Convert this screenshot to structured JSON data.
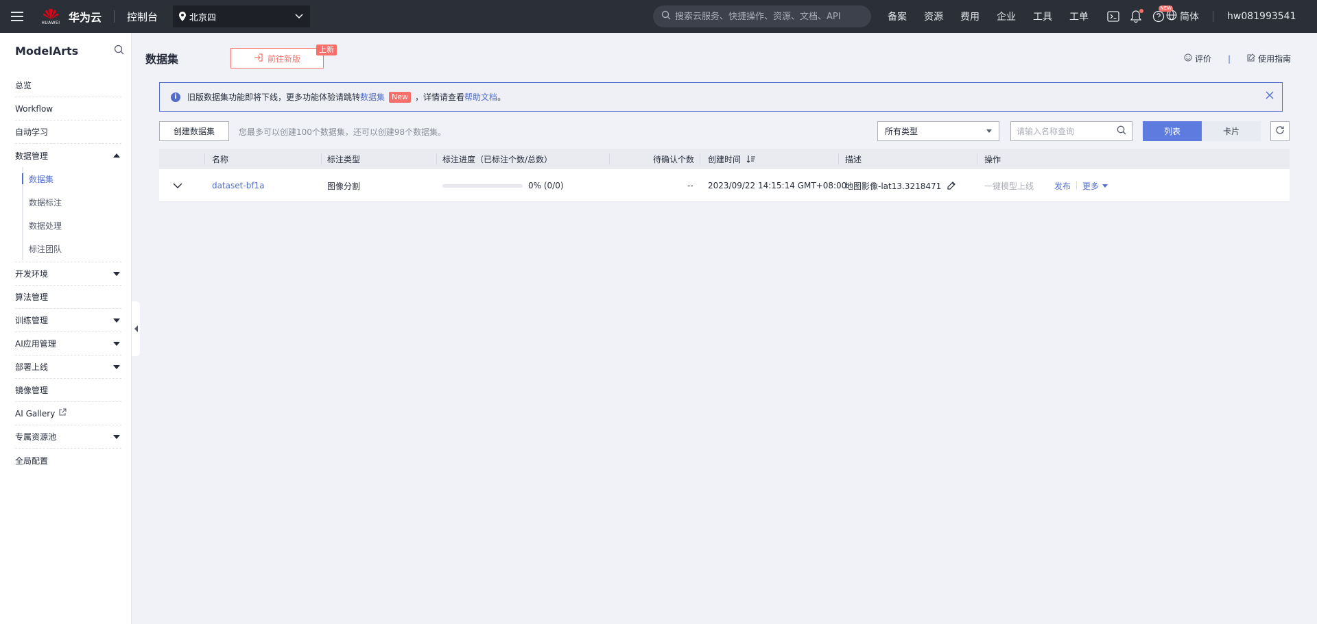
{
  "topbar": {
    "logo_text": "华为云",
    "logo_sub": "HUAWEI",
    "console": "控制台",
    "region": "北京四",
    "search_placeholder": "搜索云服务、快捷操作、资源、文档、API",
    "nav": [
      "备案",
      "资源",
      "费用",
      "企业",
      "工具",
      "工单"
    ],
    "new_tag": "NEW",
    "lang": "简体",
    "user": "hw081993541"
  },
  "sidebar": {
    "title": "ModelArts",
    "items": [
      {
        "label": "总览"
      },
      {
        "label": "Workflow"
      },
      {
        "label": "自动学习"
      },
      {
        "label": "数据管理",
        "expanded": true,
        "children": [
          "数据集",
          "数据标注",
          "数据处理",
          "标注团队"
        ],
        "active_child": 0
      },
      {
        "label": "开发环境",
        "expandable": true
      },
      {
        "label": "算法管理"
      },
      {
        "label": "训练管理",
        "expandable": true
      },
      {
        "label": "AI应用管理",
        "expandable": true
      },
      {
        "label": "部署上线",
        "expandable": true
      },
      {
        "label": "镜像管理"
      },
      {
        "label": "AI Gallery",
        "external": true
      },
      {
        "label": "专属资源池",
        "expandable": true
      },
      {
        "label": "全局配置"
      }
    ]
  },
  "page": {
    "title": "数据集",
    "new_version_btn": "前往新版",
    "new_badge": "上新",
    "rate": "评价",
    "guide": "使用指南"
  },
  "notice": {
    "text_before": "旧版数据集功能即将下线，更多功能体验请跳转",
    "link1": "数据集",
    "new_chip": "New",
    "text_middle": "，详情请查看",
    "link2": "帮助文档",
    "text_after": "。"
  },
  "toolbar": {
    "create_btn": "创建数据集",
    "quota_text": "您最多可以创建100个数据集，还可以创建98个数据集。",
    "type_select": "所有类型",
    "search_placeholder": "请输入名称查询",
    "view_list": "列表",
    "view_card": "卡片"
  },
  "table": {
    "headers": [
      "名称",
      "标注类型",
      "标注进度（已标注个数/总数）",
      "待确认个数",
      "创建时间",
      "描述",
      "操作"
    ],
    "rows": [
      {
        "name": "dataset-bf1a",
        "label_type": "图像分割",
        "progress": 0,
        "progress_text": "0% (0/0)",
        "pending": "--",
        "created": "2023/09/22 14:15:14 GMT+08:00",
        "desc": "地图影像-lat13.3218471",
        "ops": {
          "deploy": "一键模型上线",
          "publish": "发布",
          "more": "更多"
        }
      }
    ]
  },
  "colors": {
    "topbar_bg": "#2b2f38",
    "accent": "#526ecc",
    "primary_button": "#5e7ce0",
    "danger": "#f66f6a",
    "page_bg": "#f0f2f7"
  }
}
